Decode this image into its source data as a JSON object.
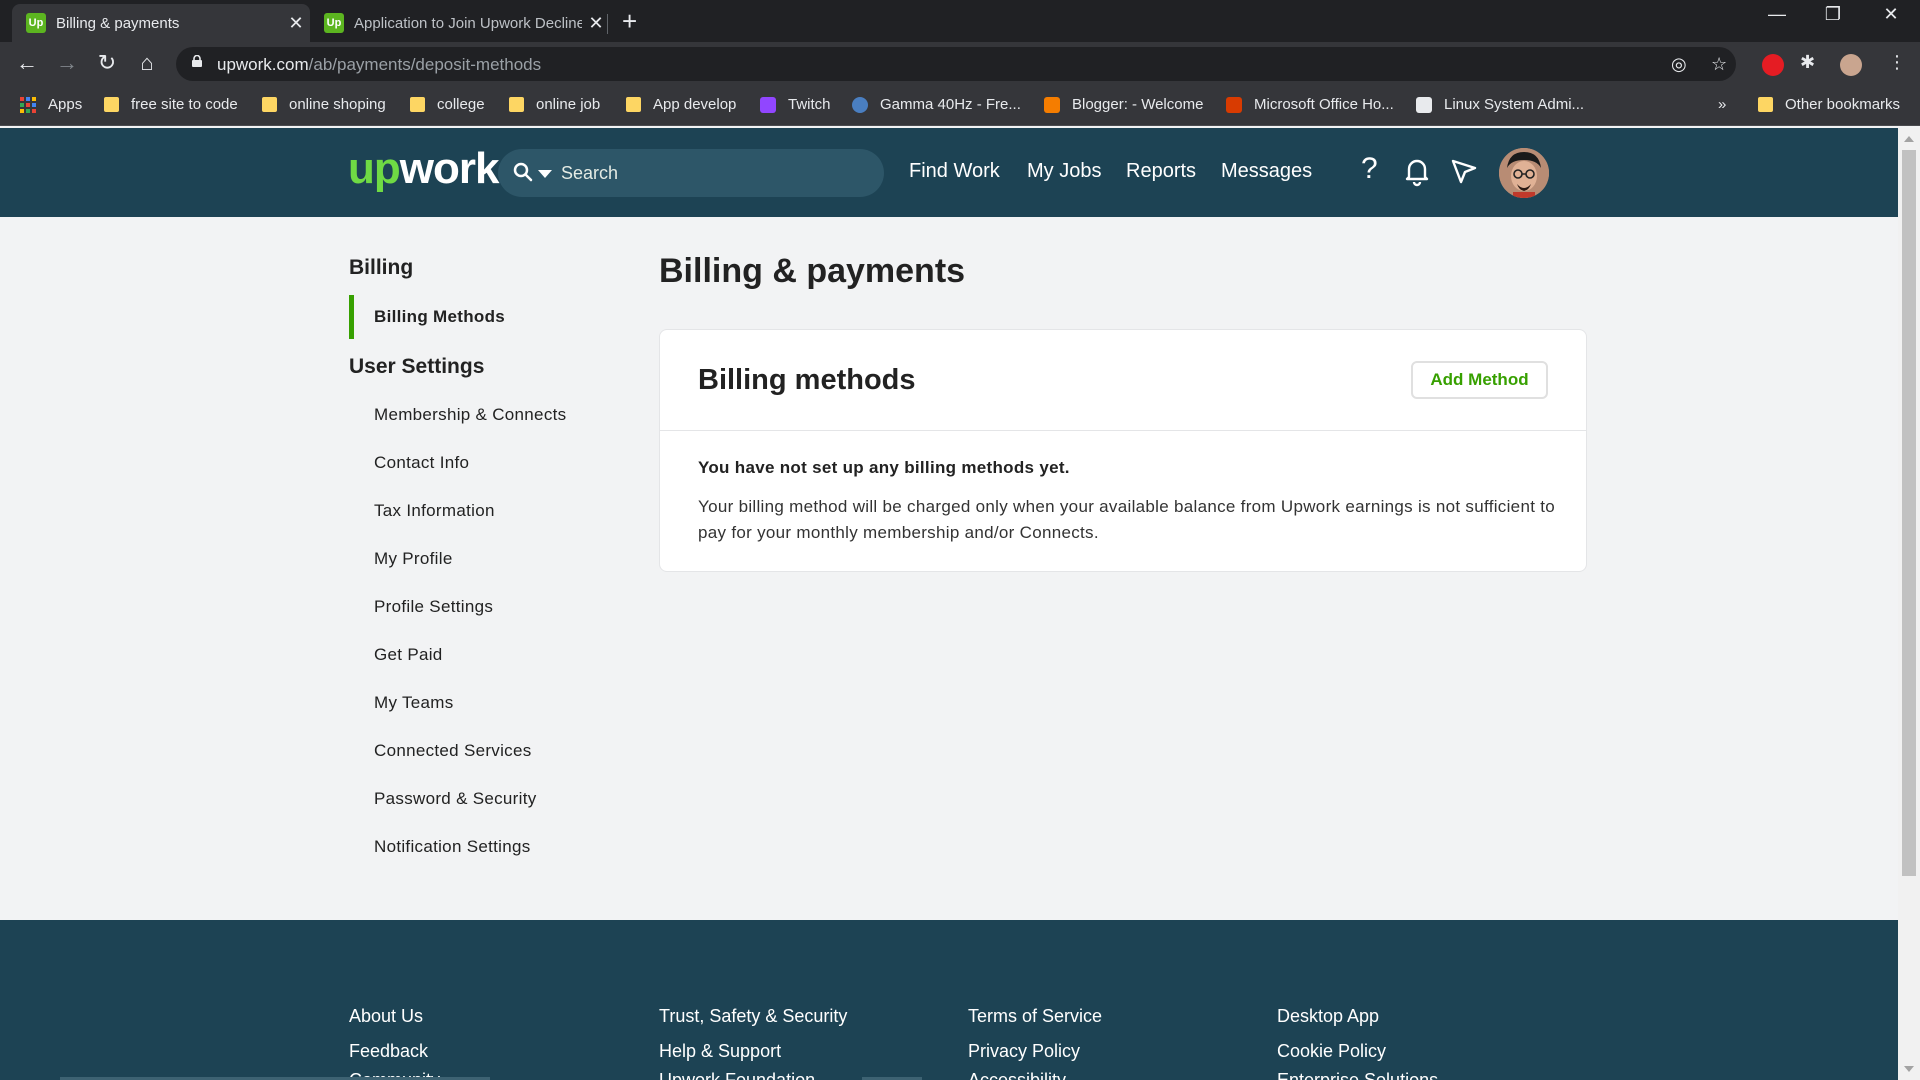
{
  "browser": {
    "tabs": [
      {
        "title": "Billing & payments",
        "active": true
      },
      {
        "title": "Application to Join Upwork Declined",
        "active": false
      }
    ],
    "favicon_text": "Up",
    "url_host": "upwork.com",
    "url_path": "/ab/payments/deposit-methods",
    "bookmarks": [
      "Apps",
      "free site to code",
      "online shoping",
      "college",
      "online job",
      "App develop",
      "Twitch",
      "Gamma 40Hz - Fre...",
      "Blogger: - Welcome",
      "Microsoft Office Ho...",
      "Linux System Admi..."
    ],
    "bookmarks_overflow": "»",
    "other_bookmarks": "Other bookmarks"
  },
  "header": {
    "logo_up": "up",
    "logo_rest": "work",
    "search_placeholder": "Search",
    "nav": [
      "Find Work",
      "My Jobs",
      "Reports",
      "Messages"
    ],
    "help_glyph": "?"
  },
  "sidebar": {
    "billing_heading": "Billing",
    "billing_items": [
      "Billing Methods"
    ],
    "user_heading": "User Settings",
    "user_items": [
      "Membership & Connects",
      "Contact Info",
      "Tax Information",
      "My Profile",
      "Profile Settings",
      "Get Paid",
      "My Teams",
      "Connected Services",
      "Password & Security",
      "Notification Settings"
    ]
  },
  "main": {
    "page_title": "Billing & payments",
    "card_title": "Billing methods",
    "add_button": "Add Method",
    "empty_title": "You have not set up any billing methods yet.",
    "description": "Your billing method will be charged only when your available balance from Upwork earnings is not sufficient to pay for your monthly membership and/or Connects."
  },
  "footer": {
    "col1": [
      "About Us",
      "Feedback",
      "Community"
    ],
    "col2": [
      "Trust, Safety & Security",
      "Help & Support",
      "Upwork Foundation"
    ],
    "col3": [
      "Terms of Service",
      "Privacy Policy",
      "Accessibility"
    ],
    "col4": [
      "Desktop App",
      "Cookie Policy",
      "Enterprise Solutions"
    ]
  },
  "colors": {
    "header_bg": "#1d4354",
    "brand_green": "#37a000",
    "logo_green": "#6fda44",
    "page_bg": "#f2f3f4"
  }
}
